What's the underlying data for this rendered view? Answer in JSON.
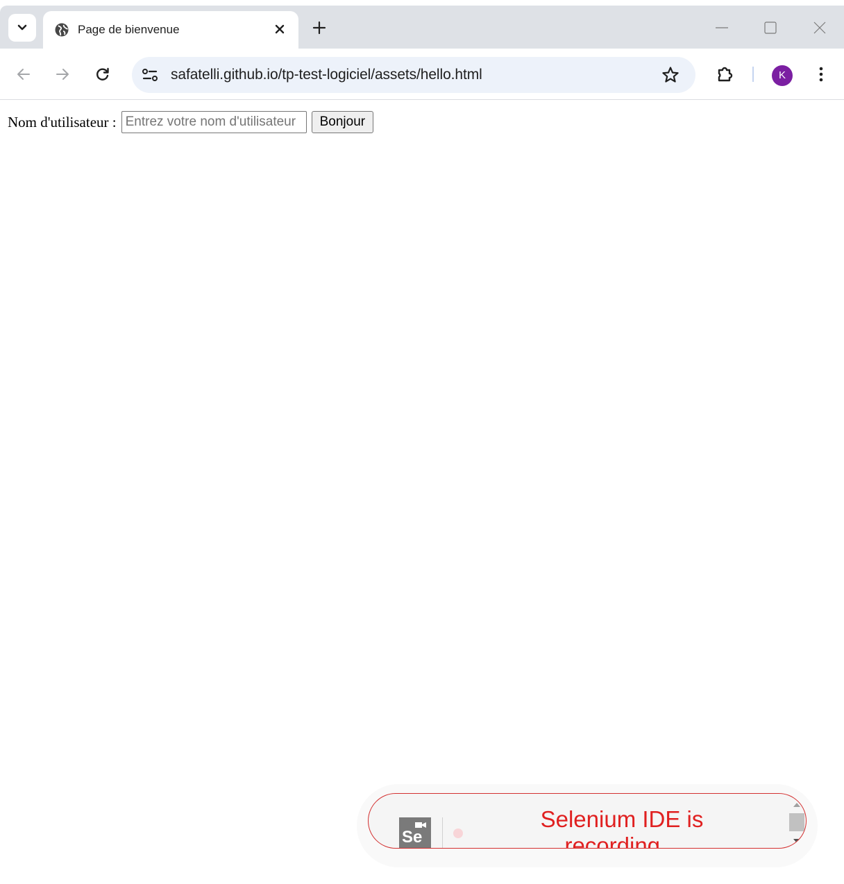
{
  "browser": {
    "tab": {
      "title": "Page de bienvenue"
    },
    "address_bar": {
      "url": "safatelli.github.io/tp-test-logiciel/assets/hello.html"
    },
    "profile_initial": "K",
    "accent_color": "#7b1fa2"
  },
  "page": {
    "username_label": "Nom d'utilisateur :",
    "username_placeholder": "Entrez votre nom d'utilisateur",
    "username_value": "",
    "greet_button_label": "Bonjour"
  },
  "selenium": {
    "logo_text": "Se",
    "status_text": "Selenium IDE is recording...",
    "status_color": "#e02020"
  }
}
